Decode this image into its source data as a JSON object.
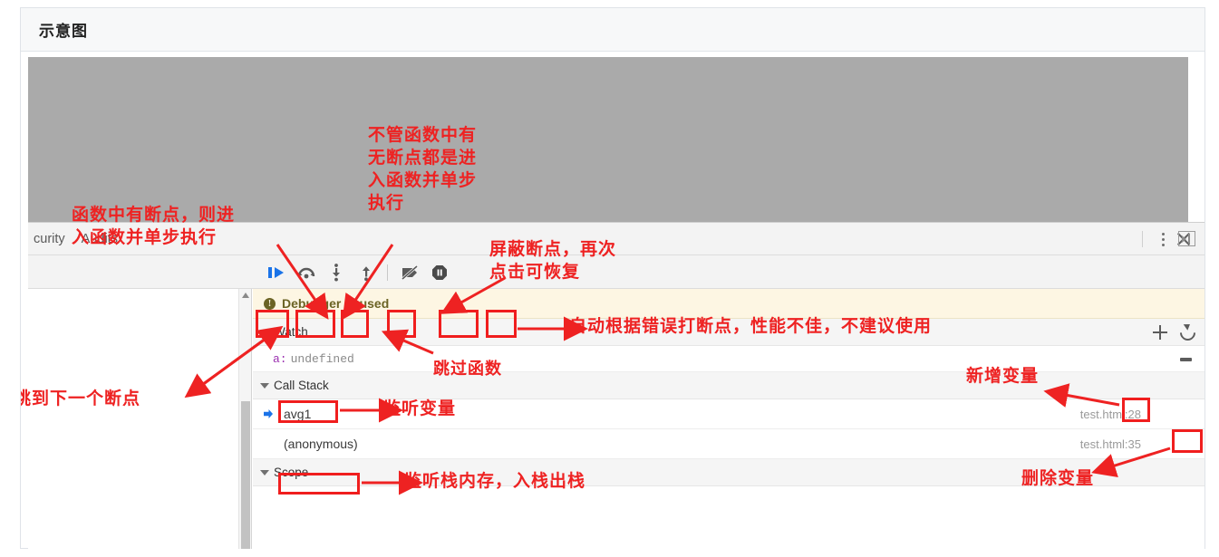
{
  "card": {
    "title": "示意图"
  },
  "devtools": {
    "tabs": [
      {
        "label": "curity"
      },
      {
        "label": "Audits"
      }
    ],
    "window_controls": {
      "kebab": "kebab-menu-icon",
      "close": "close-icon"
    },
    "left_pane": {
      "show_sidebar": "show-navigator-icon"
    },
    "debugger_buttons": [
      {
        "name": "resume-script-execution",
        "icon": "resume-icon"
      },
      {
        "name": "step-over-next-function-call",
        "icon": "step-over-icon"
      },
      {
        "name": "step-into-next-function-call",
        "icon": "step-into-icon"
      },
      {
        "name": "step-out-of-current-function",
        "icon": "step-out-icon"
      },
      {
        "name": "deactivate-breakpoints",
        "icon": "deactivate-breakpoints-icon"
      },
      {
        "name": "pause-on-exceptions",
        "icon": "pause-on-exceptions-icon"
      }
    ],
    "paused_banner": {
      "icon": "info-icon",
      "icon_glyph": "!",
      "text": "Debugger paused"
    },
    "watch": {
      "title": "Watch",
      "add_label": "+",
      "refresh_label": "refresh-icon",
      "remove_label": "−",
      "entries": [
        {
          "key": "a:",
          "value": "undefined"
        }
      ]
    },
    "call_stack": {
      "title": "Call Stack",
      "rows": [
        {
          "name": "avg1",
          "source": "test.html:28",
          "active": true
        },
        {
          "name": "(anonymous)",
          "source": "test.html:35",
          "active": false
        }
      ]
    },
    "scope": {
      "title": "Scope"
    }
  },
  "annotations": {
    "jump_next_breakpoint": "跳到下一个断点",
    "step_into_with_breakpoint": "函数中有断点，则进\n入函数并单步执行",
    "step_into_always": "不管函数中有\n无断点都是进\n入函数并单步\n执行",
    "deactivate_breakpoints": "屏蔽断点，再次\n点击可恢复",
    "pause_on_exceptions": "自动根据错误打断点，性能不佳，不建议使用",
    "step_over": "跳过函数",
    "watch_variables": "监听变量",
    "call_stack_memory": "监听栈内存，入栈出栈",
    "add_variable": "新增变量",
    "delete_variable": "删除变量"
  },
  "colors": {
    "annotation_red": "#ee2222",
    "box_red": "#f01e1e",
    "page_gray": "#aaaaaa",
    "paused_banner": "#fdf6e3",
    "resume_blue": "#1a73e8"
  }
}
